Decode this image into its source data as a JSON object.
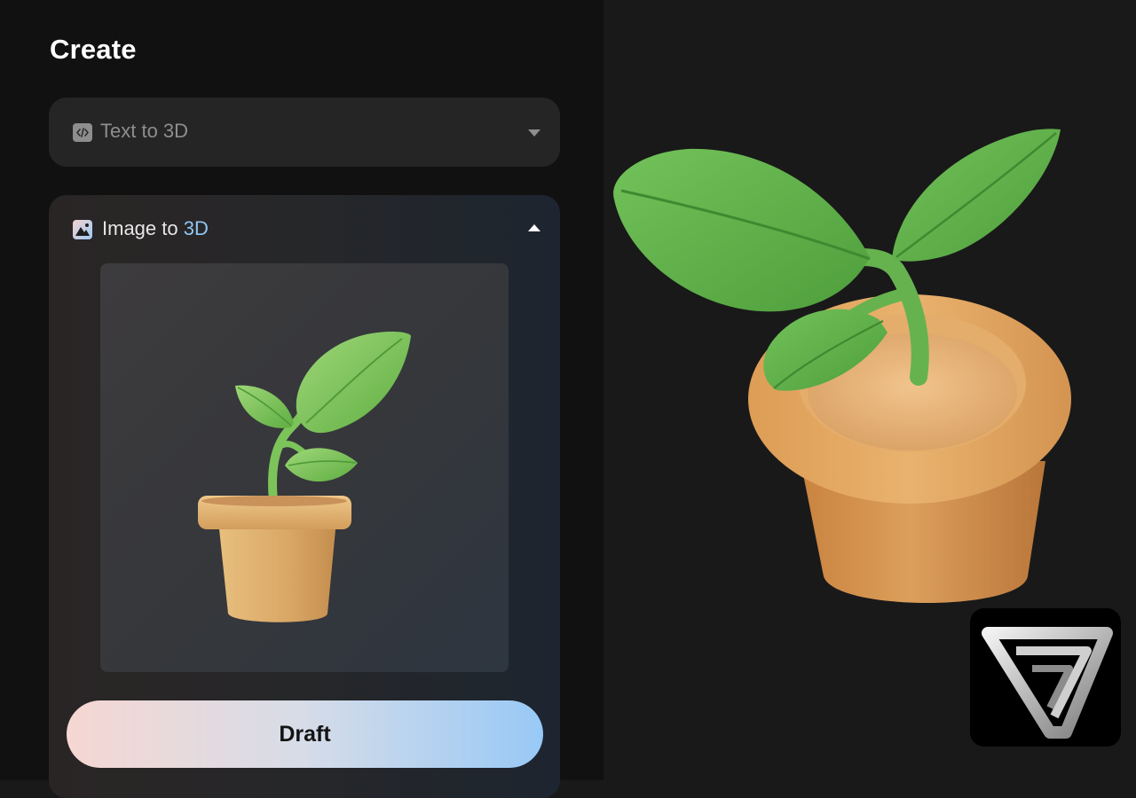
{
  "panel": {
    "title": "Create"
  },
  "text_to_3d": {
    "label": "Text to 3D",
    "icon": "code-icon",
    "chevron": "chevron-down-icon",
    "expanded": false
  },
  "image_to_3d": {
    "label_prefix": "Image to ",
    "label_accent": "3D",
    "icon": "image-icon",
    "chevron": "chevron-up-icon",
    "expanded": true,
    "preview": "potted-plant-image",
    "draft_label": "Draft"
  },
  "viewer": {
    "model": "potted-plant-3d-model",
    "logo": "app-logo"
  },
  "colors": {
    "page_bg": "#191919",
    "panel_bg": "#111111",
    "card_bg": "#252525",
    "accent_blue": "#8fc6f6",
    "draft_gradient_start": "#f6d7d2",
    "draft_gradient_end": "#98c9f6",
    "leaf_green": "#62b14b",
    "pot_tan": "#d7a361"
  }
}
